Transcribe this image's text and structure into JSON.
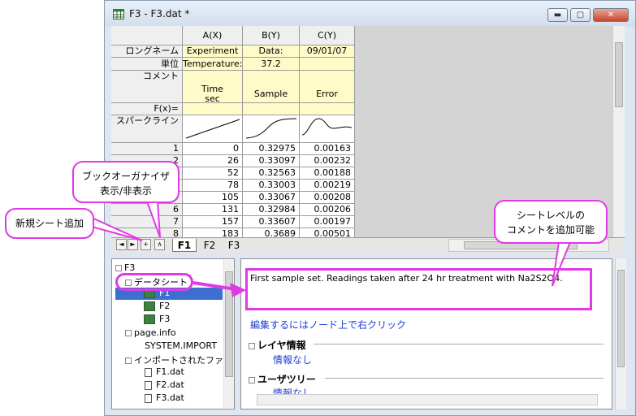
{
  "window": {
    "title": "F3 - F3.dat *",
    "controls": {
      "minimize": "▬",
      "maximize": "▢",
      "close": "✕"
    }
  },
  "sheet": {
    "columns": [
      "A(X)",
      "B(Y)",
      "C(Y)"
    ],
    "label_rows": {
      "long_name": "ロングネーム",
      "units": "単位",
      "comments": "コメント",
      "fx": "F(x)=",
      "sparklines": "スパークライン"
    },
    "long_names": [
      "Experiment",
      "Data:",
      "09/01/07"
    ],
    "units": [
      "Temperature:",
      "37.2",
      ""
    ],
    "comments": [
      "Time\nsec",
      "Sample",
      "Error"
    ],
    "rows": [
      {
        "n": "1",
        "a": "0",
        "b": "0.32975",
        "c": "0.00163"
      },
      {
        "n": "2",
        "a": "26",
        "b": "0.33097",
        "c": "0.00232"
      },
      {
        "n": "3",
        "a": "52",
        "b": "0.32563",
        "c": "0.00188"
      },
      {
        "n": "4",
        "a": "78",
        "b": "0.33003",
        "c": "0.00219"
      },
      {
        "n": "5",
        "a": "105",
        "b": "0.33067",
        "c": "0.00208"
      },
      {
        "n": "6",
        "a": "131",
        "b": "0.32984",
        "c": "0.00206"
      },
      {
        "n": "7",
        "a": "157",
        "b": "0.33607",
        "c": "0.00197"
      },
      {
        "n": "8",
        "a": "183",
        "b": "0.3689",
        "c": "0.00501"
      }
    ]
  },
  "tabs": {
    "nav": [
      "◄",
      "►",
      "+",
      "∧"
    ],
    "sheets": [
      "F1",
      "F2",
      "F3"
    ]
  },
  "organizer": {
    "root": "F3",
    "datasheets_label": "データシート",
    "sheets": [
      "F1",
      "F2",
      "F3"
    ],
    "page_info": "page.info",
    "system_import": "SYSTEM.IMPORT",
    "imported_files_label": "インポートされたファイル",
    "files": [
      "F1.dat",
      "F2.dat",
      "F3.dat"
    ]
  },
  "info_panel": {
    "comment": "First sample set. Readings taken after 24 hr treatment with Na2S2O4.",
    "hint": "編集するにはノード上で右クリック",
    "layer_info": "レイヤ情報",
    "layer_info_value": "情報なし",
    "user_tree": "ユーザツリー",
    "user_tree_value": "情報なし"
  },
  "callouts": {
    "organizer_toggle": "ブックオーガナイザ\n表示/非表示",
    "add_sheet": "新規シート追加",
    "sheet_comment": "シートレベルの\nコメントを追加可能"
  },
  "colors": {
    "callout_border": "#e239e6",
    "selected_row": "#3d6fd1",
    "link_blue": "#1b3fd1"
  }
}
